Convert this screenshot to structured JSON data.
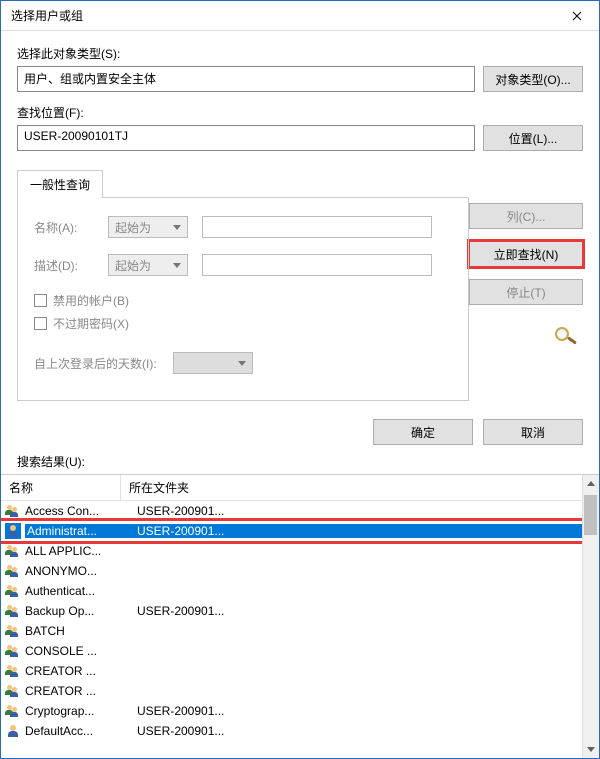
{
  "window": {
    "title": "选择用户或组"
  },
  "objectType": {
    "label": "选择此对象类型(S):",
    "value": "用户、组或内置安全主体",
    "button": "对象类型(O)..."
  },
  "location": {
    "label": "查找位置(F):",
    "value": "USER-20090101TJ",
    "button": "位置(L)..."
  },
  "tab": {
    "general": "一般性查询"
  },
  "query": {
    "nameLabel": "名称(A):",
    "nameCombo": "起始为",
    "descLabel": "描述(D):",
    "descCombo": "起始为",
    "chkDisabled": "禁用的帐户(B)",
    "chkNoExpire": "不过期密码(X)",
    "daysLabel": "自上次登录后的天数(I):"
  },
  "sideButtons": {
    "columns": "列(C)...",
    "findNow": "立即查找(N)",
    "stop": "停止(T)"
  },
  "footer": {
    "ok": "确定",
    "cancel": "取消"
  },
  "results": {
    "label": "搜索结果(U):",
    "colName": "名称",
    "colFolder": "所在文件夹",
    "rows": [
      {
        "name": "Access Con...",
        "folder": "USER-200901...",
        "type": "group"
      },
      {
        "name": "Administrat...",
        "folder": "USER-200901...",
        "type": "user",
        "selected": true
      },
      {
        "name": "ALL APPLIC...",
        "folder": "",
        "type": "group"
      },
      {
        "name": "ANONYMO...",
        "folder": "",
        "type": "group"
      },
      {
        "name": "Authenticat...",
        "folder": "",
        "type": "group"
      },
      {
        "name": "Backup Op...",
        "folder": "USER-200901...",
        "type": "group"
      },
      {
        "name": "BATCH",
        "folder": "",
        "type": "group"
      },
      {
        "name": "CONSOLE ...",
        "folder": "",
        "type": "group"
      },
      {
        "name": "CREATOR ...",
        "folder": "",
        "type": "group"
      },
      {
        "name": "CREATOR ...",
        "folder": "",
        "type": "group"
      },
      {
        "name": "Cryptograp...",
        "folder": "USER-200901...",
        "type": "group"
      },
      {
        "name": "DefaultAcc...",
        "folder": "USER-200901...",
        "type": "user"
      }
    ]
  }
}
